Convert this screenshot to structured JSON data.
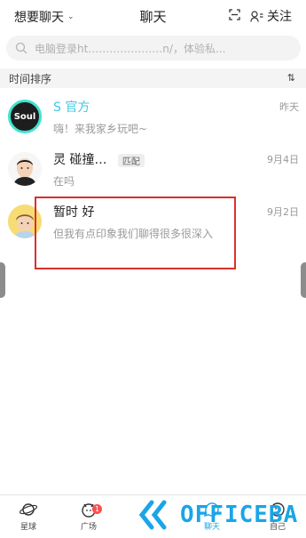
{
  "header": {
    "mode_label": "想要聊天",
    "title": "聊天",
    "follow_label": "关注"
  },
  "search": {
    "placeholder": "电脑登录ht…………………n/，体验私..."
  },
  "sort": {
    "label": "时间排序"
  },
  "conversations": [
    {
      "name": "S   官方",
      "preview": "嗨！来我家乡玩吧~",
      "time": "昨天",
      "tag": ""
    },
    {
      "name": "灵   碰撞…",
      "preview": "在吗",
      "time": "9月4日",
      "tag": "匹配"
    },
    {
      "name": "暂时    好",
      "preview": "但我有点印象我们聊得很多很深入",
      "time": "9月2日",
      "tag": ""
    }
  ],
  "avatar_text": "Soul",
  "nav": {
    "planet": "星球",
    "square": "广场",
    "square_badge": "1",
    "chat": "聊天",
    "me": "自己"
  },
  "watermark": {
    "text": "OFFICEBA"
  },
  "colors": {
    "accent": "#1aa5e8",
    "highlight_box": "#d9302b",
    "badge": "#ff4d4d"
  }
}
